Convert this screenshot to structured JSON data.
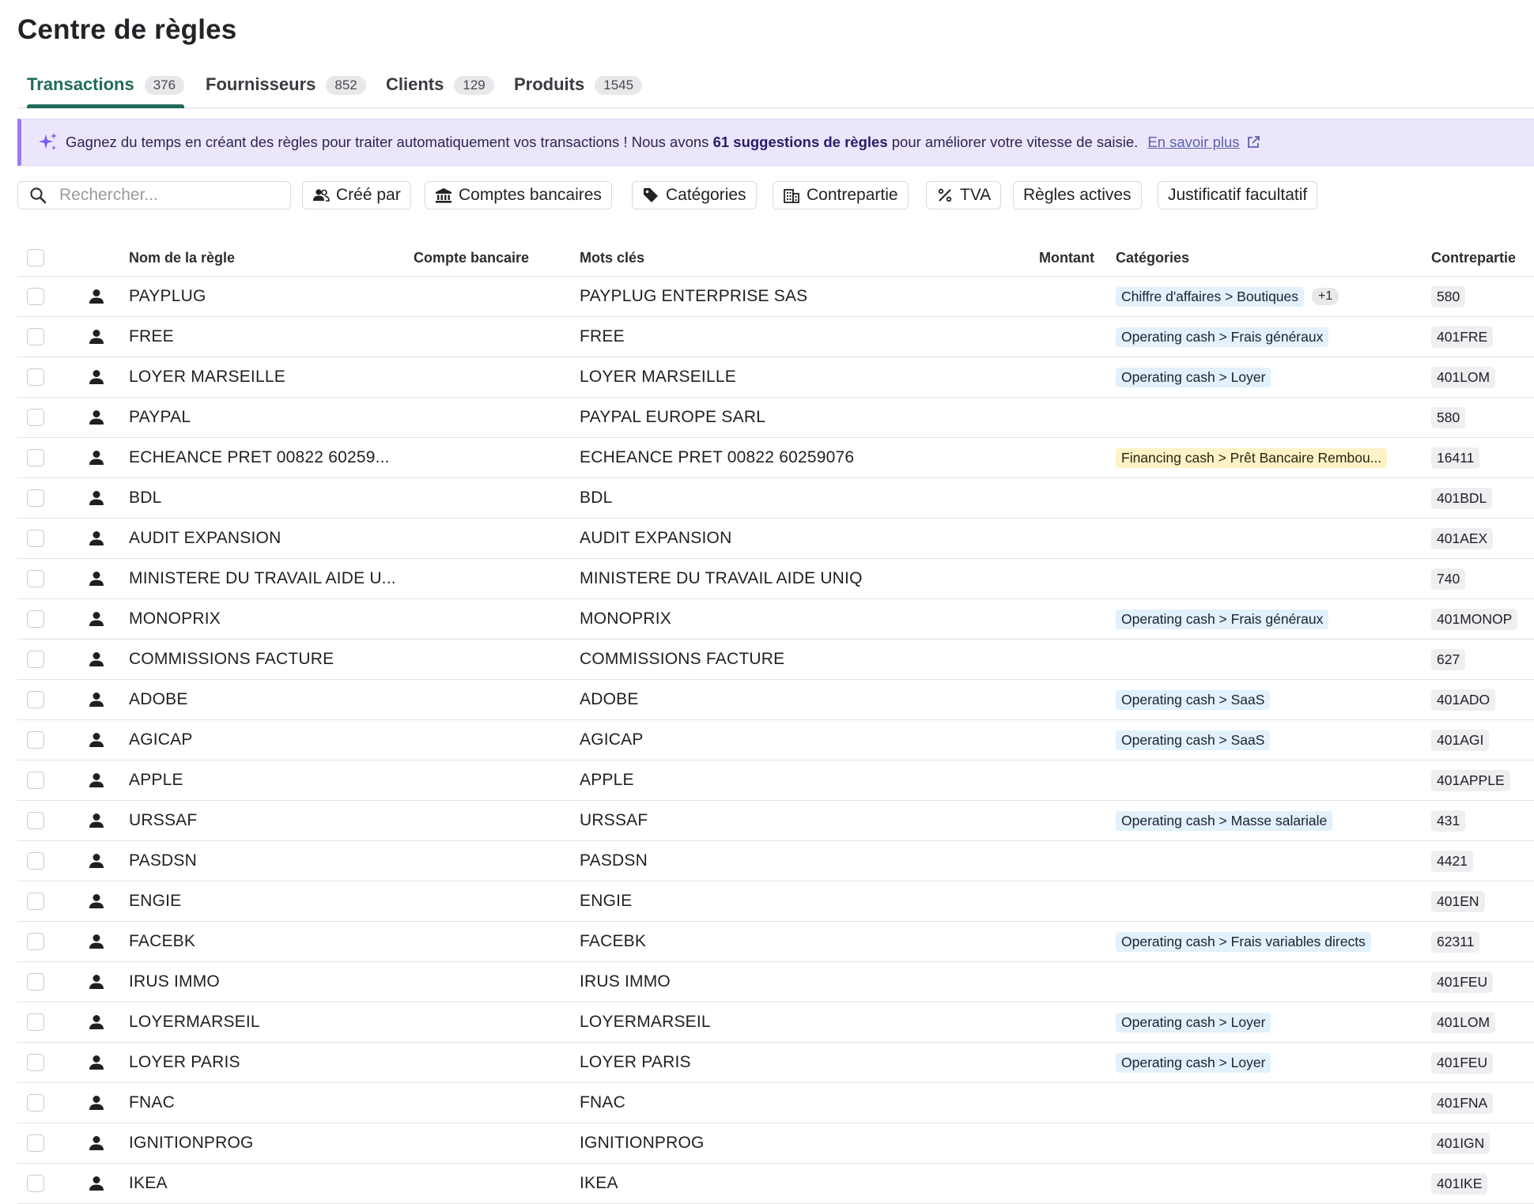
{
  "page": {
    "title": "Centre de règles"
  },
  "tabs": [
    {
      "label": "Transactions",
      "count": "376",
      "active": true
    },
    {
      "label": "Fournisseurs",
      "count": "852"
    },
    {
      "label": "Clients",
      "count": "129"
    },
    {
      "label": "Produits",
      "count": "1545"
    }
  ],
  "banner": {
    "text_before": "Gagnez du temps en créant des règles pour traiter automatiquement vos transactions ! Nous avons",
    "highlight": "61 suggestions de règles",
    "text_after": "pour améliorer votre vitesse de saisie.",
    "link": "En savoir plus",
    "icon": "sparkle-icon"
  },
  "search": {
    "placeholder": "Rechercher...",
    "value": ""
  },
  "filters": [
    {
      "label": "Créé par",
      "icon": "users-icon"
    },
    {
      "label": "Comptes bancaires",
      "icon": "bank-icon"
    },
    {
      "label": "Catégories",
      "icon": "tag-icon"
    },
    {
      "label": "Contrepartie",
      "icon": "building-icon"
    },
    {
      "label": "TVA",
      "icon": "percent-icon"
    },
    {
      "label": "Règles actives",
      "icon": ""
    },
    {
      "label": "Justificatif facultatif",
      "icon": ""
    }
  ],
  "table": {
    "columns": {
      "name": "Nom de la règle",
      "bank": "Compte bancaire",
      "keywords": "Mots clés",
      "amount": "Montant",
      "categories": "Catégories",
      "counterpart": "Contrepartie"
    },
    "rows": [
      {
        "name": "PAYPLUG",
        "keywords": "PAYPLUG ENTERPRISE SAS",
        "category": "Chiffre d'affaires > Boutiques",
        "category_color": "blue",
        "category_more": "+1",
        "counterpart": "580"
      },
      {
        "name": "FREE",
        "keywords": "FREE",
        "category": "Operating cash > Frais généraux",
        "category_color": "blue",
        "counterpart": "401FRE"
      },
      {
        "name": "LOYER MARSEILLE",
        "keywords": "LOYER MARSEILLE",
        "category": "Operating cash > Loyer",
        "category_color": "blue",
        "counterpart": "401LOM"
      },
      {
        "name": "PAYPAL",
        "keywords": "PAYPAL EUROPE SARL",
        "category": "",
        "counterpart": "580"
      },
      {
        "name": "ECHEANCE PRET 00822 60259...",
        "keywords": "ECHEANCE PRET 00822 60259076",
        "category": "Financing cash > Prêt Bancaire Rembou...",
        "category_color": "yellow",
        "counterpart": "16411"
      },
      {
        "name": "BDL",
        "keywords": "BDL",
        "category": "",
        "counterpart": "401BDL"
      },
      {
        "name": "AUDIT EXPANSION",
        "keywords": "AUDIT EXPANSION",
        "category": "",
        "counterpart": "401AEX"
      },
      {
        "name": "MINISTERE DU TRAVAIL AIDE U...",
        "keywords": "MINISTERE DU TRAVAIL AIDE UNIQ",
        "category": "",
        "counterpart": "740"
      },
      {
        "name": "MONOPRIX",
        "keywords": "MONOPRIX",
        "category": "Operating cash > Frais généraux",
        "category_color": "blue",
        "counterpart": "401MONOP"
      },
      {
        "name": "COMMISSIONS FACTURE",
        "keywords": "COMMISSIONS FACTURE",
        "category": "",
        "counterpart": "627"
      },
      {
        "name": "ADOBE",
        "keywords": "ADOBE",
        "category": "Operating cash > SaaS",
        "category_color": "blue",
        "counterpart": "401ADO"
      },
      {
        "name": "AGICAP",
        "keywords": "AGICAP",
        "category": "Operating cash > SaaS",
        "category_color": "blue",
        "counterpart": "401AGI"
      },
      {
        "name": "APPLE",
        "keywords": "APPLE",
        "category": "",
        "counterpart": "401APPLE"
      },
      {
        "name": "URSSAF",
        "keywords": "URSSAF",
        "category": "Operating cash > Masse salariale",
        "category_color": "blue",
        "counterpart": "431"
      },
      {
        "name": "PASDSN",
        "keywords": "PASDSN",
        "category": "",
        "counterpart": "4421"
      },
      {
        "name": "ENGIE",
        "keywords": "ENGIE",
        "category": "",
        "counterpart": "401EN"
      },
      {
        "name": "FACEBK",
        "keywords": "FACEBK",
        "category": "Operating cash > Frais variables directs",
        "category_color": "blue",
        "counterpart": "62311"
      },
      {
        "name": "IRUS IMMO",
        "keywords": "IRUS IMMO",
        "category": "",
        "counterpart": "401FEU"
      },
      {
        "name": "LOYERMARSEIL",
        "keywords": "LOYERMARSEIL",
        "category": "Operating cash > Loyer",
        "category_color": "blue",
        "counterpart": "401LOM"
      },
      {
        "name": "LOYER PARIS",
        "keywords": "LOYER PARIS",
        "category": "Operating cash > Loyer",
        "category_color": "blue",
        "counterpart": "401FEU"
      },
      {
        "name": "FNAC",
        "keywords": "FNAC",
        "category": "",
        "counterpart": "401FNA"
      },
      {
        "name": "IGNITIONPROG",
        "keywords": "IGNITIONPROG",
        "category": "",
        "counterpart": "401IGN"
      },
      {
        "name": "IKEA",
        "keywords": "IKEA",
        "category": "",
        "counterpart": "401IKE"
      }
    ]
  },
  "colors": {
    "accent": "#1f6b5b",
    "banner_bg": "#ece6fd",
    "banner_border": "#9b7bf5",
    "category_blue": "#e2f1fb",
    "category_yellow": "#fdf3c7"
  }
}
